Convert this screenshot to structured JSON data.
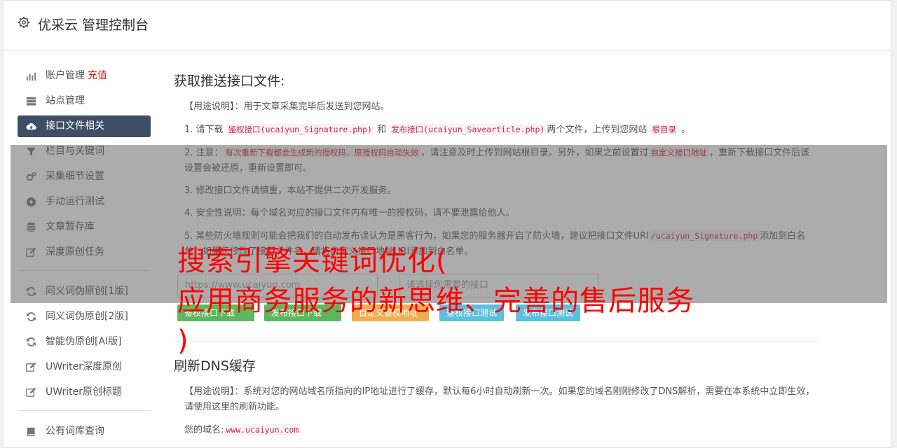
{
  "header": {
    "title": "优采云 管理控制台"
  },
  "sidebar": {
    "items": [
      {
        "label": "账户管理",
        "extra": "充值",
        "icon": "bar-chart-icon"
      },
      {
        "label": "站点管理",
        "icon": "server-icon"
      },
      {
        "label": "接口文件相关",
        "icon": "cloud-upload-icon",
        "active": true
      },
      {
        "label": "栏目与关键词",
        "icon": "filter-icon"
      },
      {
        "label": "采集细节设置",
        "icon": "cogs-icon"
      },
      {
        "label": "手动运行测试",
        "icon": "play-icon"
      },
      {
        "label": "文章暂存库",
        "icon": "database-icon"
      },
      {
        "label": "深度原创任务",
        "icon": "edit-icon"
      }
    ],
    "items2": [
      {
        "label": "同义词伪原创[1版]",
        "icon": "refresh-icon"
      },
      {
        "label": "同义词伪原创[2版]",
        "icon": "refresh-icon"
      },
      {
        "label": "智能伪原创[AI版]",
        "icon": "refresh-icon"
      },
      {
        "label": "UWriter深度原创",
        "icon": "edit-icon"
      },
      {
        "label": "UWriter原创标题",
        "icon": "edit-icon"
      }
    ],
    "items3": [
      {
        "label": "公有词库查询",
        "icon": "book-icon"
      }
    ]
  },
  "main": {
    "section1": {
      "title": "获取推送接口文件:",
      "usage_prefix": "【用途说明】：用于文章采集完毕后发送到您网站。",
      "p1_a": "1. 请下载",
      "p1_code1": "鉴权接口(ucaiyun_Signature.php)",
      "p1_b": "和",
      "p1_code2": "发布接口(ucaiyun_Savearticle.php)",
      "p1_c": "两个文件，上传到您网站",
      "p1_code3": "根目录",
      "p1_d": "。",
      "p2_a": "2. 注意：",
      "p2_code1": "每次重新下载都会生成新的授权码，原授权码自动失效",
      "p2_b": "，请注意及时上传到网站根目录。另外，如果之前设置过",
      "p2_code2": "自定义接口地址",
      "p2_c": "，重新下载接口文件后该设置会被还原，重新设置即可。",
      "p3": "3. 修改接口文件请慎重，本站不提供二次开发服务。",
      "p4": "4. 安全性说明：每个域名对应的接口文件内有唯一的授权码，请不要泄露给他人。",
      "p5_a": "5. 某些防火墙规则可能会把我们的自动发布误认为是黑客行为，如果您的服务器开启了防火墙，建议把接口文件URI",
      "p5_code": "/ucaiyun_Signature.php",
      "p5_b": "添加到白名单，如果您修改了接口文件名，请将自定义接口地址URI添加到白名单。",
      "url_placeholder": "https://www.ucaiyun.com",
      "select_placeholder": "请选择您需要的接口",
      "buttons": [
        "鉴权接口下载",
        "发布接口下载",
        "自定义鉴权地址",
        "鉴权接口测试",
        "发布接口测试"
      ]
    },
    "section2": {
      "title": "刷新DNS缓存",
      "usage": "【用途说明】：系统对您的网站域名所指向的IP地址进行了缓存，默认每6小时自动刷新一次。如果您的域名刚刚修改了DNS解析，需要在本系统中立即生效，请使用这里的刷新功能。",
      "domain_label": "您的域名:",
      "domain_value": "www.ucaiyun.com"
    }
  },
  "promo": {
    "line1": "搜索引擎关键词优化(",
    "line2": "应用商务服务的新思维、完善的售后服务",
    "line3": ")"
  },
  "colors": {
    "active_nav": "#3d4f66",
    "btn_green": "#5cb85c",
    "btn_orange": "#f0ad4e",
    "btn_blue": "#5bc0de",
    "promo_red": "#ff0000"
  }
}
